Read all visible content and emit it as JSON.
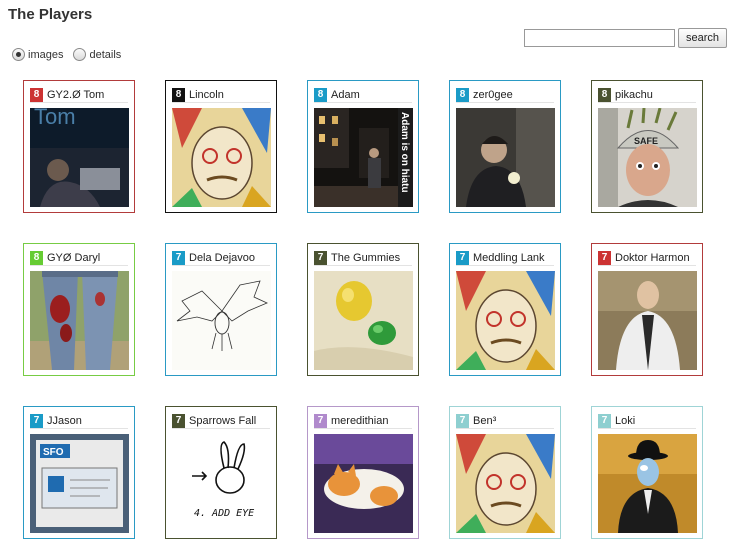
{
  "header": {
    "title": "The Players"
  },
  "view_toggle": {
    "options": [
      {
        "label": "images",
        "checked": true
      },
      {
        "label": "details",
        "checked": false
      }
    ]
  },
  "search": {
    "value": "",
    "button_label": "search"
  },
  "players": [
    {
      "name": "GY2.Ø Tom",
      "level": "8",
      "badge_color": "#cc3333",
      "border_color": "#b23b3b",
      "photo_icon": "person-at-laptop-photo",
      "photo_text": "Tom"
    },
    {
      "name": "Lincoln",
      "level": "8",
      "badge_color": "#111111",
      "border_color": "#111111",
      "photo_icon": "painted-face-photo"
    },
    {
      "name": "Adam",
      "level": "8",
      "badge_color": "#1a9bc7",
      "border_color": "#2a9ac4",
      "photo_icon": "night-street-photo",
      "photo_text": "Adam is on hiatu"
    },
    {
      "name": "zer0gee",
      "level": "8",
      "badge_color": "#1a9bc7",
      "border_color": "#2a9ac4",
      "photo_icon": "person-with-flashlight-photo"
    },
    {
      "name": "pikachu",
      "level": "8",
      "badge_color": "#4a5230",
      "border_color": "#4a5230",
      "photo_icon": "person-with-helmet-photo",
      "photo_text": "SAFE"
    },
    {
      "name": "GYØ Daryl",
      "level": "8",
      "badge_color": "#66cc33",
      "border_color": "#77cc44",
      "photo_icon": "paint-splattered-jeans-photo"
    },
    {
      "name": "Dela Dejavoo",
      "level": "7",
      "badge_color": "#1a9bc7",
      "border_color": "#2a9ac4",
      "photo_icon": "bat-sketch-photo"
    },
    {
      "name": "The Gummies",
      "level": "7",
      "badge_color": "#4a5230",
      "border_color": "#4a5230",
      "photo_icon": "gummy-candies-photo"
    },
    {
      "name": "Meddling Lank",
      "level": "7",
      "badge_color": "#1a9bc7",
      "border_color": "#2a9ac4",
      "photo_icon": "painted-face-photo"
    },
    {
      "name": "Doktor Harmon",
      "level": "7",
      "badge_color": "#cc3333",
      "border_color": "#b23b3b",
      "photo_icon": "man-in-labcoat-photo"
    },
    {
      "name": "JJason",
      "level": "7",
      "badge_color": "#1a9bc7",
      "border_color": "#2a9ac4",
      "photo_icon": "sfo-sign-photo",
      "photo_text": "SFO"
    },
    {
      "name": "Sparrows Fall",
      "level": "7",
      "badge_color": "#4a5230",
      "border_color": "#4a5230",
      "photo_icon": "rabbit-sketch-photo",
      "photo_text": "4. ADD EYE"
    },
    {
      "name": "meredithian",
      "level": "7",
      "badge_color": "#b08acc",
      "border_color": "#b598c9",
      "photo_icon": "sleeping-cat-photo"
    },
    {
      "name": "Ben³",
      "level": "7",
      "badge_color": "#8ecfd0",
      "border_color": "#9fd4d6",
      "photo_icon": "painted-face-photo"
    },
    {
      "name": "Loki",
      "level": "7",
      "badge_color": "#8ecfd0",
      "border_color": "#9fd4d6",
      "photo_icon": "bowler-hat-man-photo"
    }
  ]
}
